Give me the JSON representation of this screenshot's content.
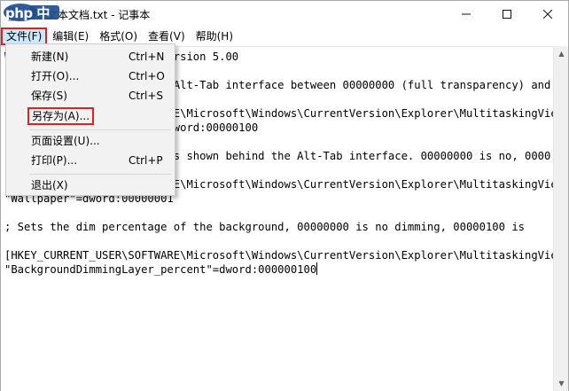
{
  "window": {
    "title": "新建文本文档.txt - 记事本",
    "watermark": "php 中文网",
    "controls": {
      "minimize": "—",
      "maximize": "☐",
      "close": "✕"
    }
  },
  "menubar": {
    "items": [
      {
        "label": "文件(F)"
      },
      {
        "label": "编辑(E)"
      },
      {
        "label": "格式(O)"
      },
      {
        "label": "查看(V)"
      },
      {
        "label": "帮助(H)"
      }
    ]
  },
  "file_menu": {
    "items": [
      {
        "label": "新建(N)",
        "shortcut": "Ctrl+N"
      },
      {
        "label": "打开(O)...",
        "shortcut": "Ctrl+O"
      },
      {
        "label": "保存(S)",
        "shortcut": "Ctrl+S"
      },
      {
        "label": "另存为(A)...",
        "shortcut": ""
      },
      {
        "label": "页面设置(U)...",
        "shortcut": ""
      },
      {
        "label": "打印(P)...",
        "shortcut": "Ctrl+P"
      },
      {
        "label": "退出(X)",
        "shortcut": ""
      }
    ]
  },
  "editor": {
    "lines": [
      "Windows Registry Editor Version 5.00",
      "",
      "; Sets the opacity of the Alt-Tab interface between 00000000 (full transparency) and",
      "",
      "[HKEY_CURRENT_USER\\SOFTWARE\\Microsoft\\Windows\\CurrentVersion\\Explorer\\MultitaskingView",
      "\"Grid_backgroundPercent\"=dword:00000100",
      "",
      "; Sets whether wallpaper is shown behind the Alt-Tab interface. 00000000 is no, 0000",
      "",
      "[HKEY_CURRENT_USER\\SOFTWARE\\Microsoft\\Windows\\CurrentVersion\\Explorer\\MultitaskingView",
      "\"Wallpaper\"=dword:00000001",
      "",
      "; Sets the dim percentage of the background, 00000000 is no dimming, 00000100 is",
      "",
      "[HKEY_CURRENT_USER\\SOFTWARE\\Microsoft\\Windows\\CurrentVersion\\Explorer\\MultitaskingView",
      "\"BackgroundDimmingLayer_percent\"=dword:000000100"
    ]
  },
  "scrollbar": {
    "up": "▲",
    "down": "▼"
  },
  "colors": {
    "highlight_border": "#e0211f",
    "menu_active_bg": "#cce8ff",
    "watermark_bg": "#1f4e8c"
  }
}
